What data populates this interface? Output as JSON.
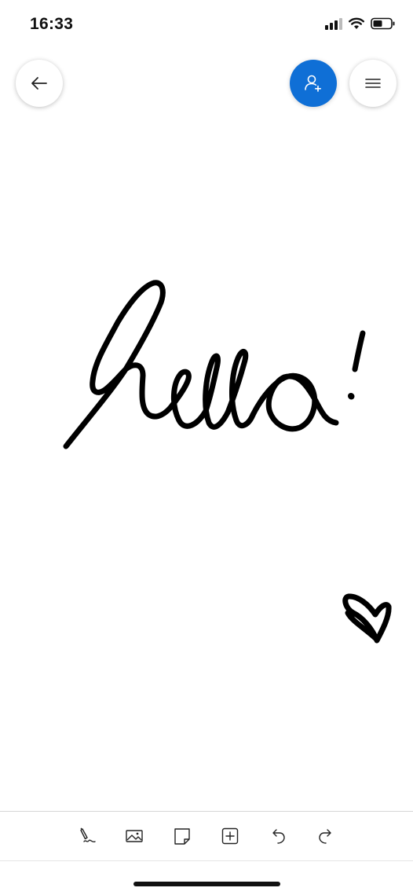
{
  "status": {
    "time": "16:33",
    "icons": [
      "cellular-signal-icon",
      "wifi-icon",
      "battery-icon"
    ]
  },
  "header": {
    "back": {
      "icon": "arrow-left-icon"
    },
    "share": {
      "icon": "add-person-icon"
    },
    "menu": {
      "icon": "hamburger-menu-icon"
    }
  },
  "canvas": {
    "ink_text": "hello!",
    "doodles": [
      "heart"
    ]
  },
  "toolbar": {
    "tools": [
      {
        "name": "pen",
        "icon": "pen-icon"
      },
      {
        "name": "image",
        "icon": "image-icon"
      },
      {
        "name": "sticky-note",
        "icon": "sticky-note-icon"
      },
      {
        "name": "add",
        "icon": "add-box-icon"
      },
      {
        "name": "undo",
        "icon": "undo-icon"
      },
      {
        "name": "redo",
        "icon": "redo-icon"
      }
    ]
  },
  "colors": {
    "accent": "#0f6fd6",
    "ink": "#000000",
    "background": "#ffffff"
  }
}
